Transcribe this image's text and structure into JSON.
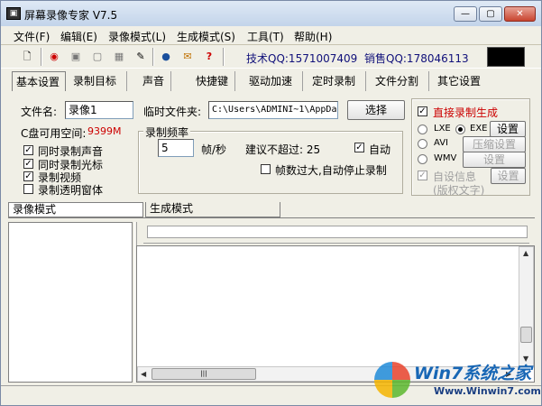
{
  "window": {
    "title": "屏幕录像专家 V7.5",
    "min": "—",
    "max": "▢",
    "close": "✕"
  },
  "menu": [
    "文件(F)",
    "编辑(E)",
    "录像模式(L)",
    "生成模式(S)",
    "工具(T)",
    "帮助(H)"
  ],
  "toolbar": {
    "support_qq": "技术QQ:1571007409",
    "sales_qq": "销售QQ:178046113"
  },
  "tabs": [
    "基本设置",
    "录制目标",
    "声音",
    "快捷键",
    "驱动加速",
    "定时录制",
    "文件分割",
    "其它设置"
  ],
  "basic": {
    "filename_label": "文件名:",
    "filename_value": "录像1",
    "tempdir_label": "临时文件夹:",
    "tempdir_value": "C:\\Users\\ADMINI~1\\AppDa",
    "choose_button": "选择",
    "disk_label": "C盘可用空间:",
    "disk_value": "9399M",
    "options": [
      {
        "label": "同时录制声音",
        "checked": true
      },
      {
        "label": "同时录制光标",
        "checked": true
      },
      {
        "label": "录制视频",
        "checked": true
      },
      {
        "label": "录制透明窗体",
        "checked": false
      }
    ],
    "freq_group": "录制频率",
    "fps_value": "5",
    "fps_unit": "帧/秒",
    "suggest_label": "建议不超过: 25",
    "auto_label": "自动",
    "auto_checked": true,
    "stop_label": "帧数过大,自动停止录制",
    "stop_checked": false
  },
  "output": {
    "direct_label": "直接录制生成",
    "direct_checked": true,
    "lxe": "LXE",
    "exe": "EXE",
    "avi": "AVI",
    "wmv": "WMV",
    "exe_settings": "设置",
    "compress_settings": "压缩设置",
    "wmv_settings": "设置",
    "custom_info_label": "自设信息",
    "custom_info_sub": "(版权文字)",
    "custom_settings": "设置"
  },
  "lower_tabs": {
    "record_mode": "录像模式",
    "generate_mode": "生成模式"
  },
  "scroll_mark": "|||",
  "watermark": {
    "brand": "Win7系统之家",
    "url": "Www.Winwin7.com"
  }
}
